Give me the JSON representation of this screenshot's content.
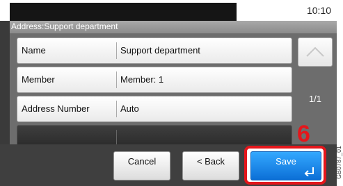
{
  "status_bar": {
    "time": "10:10"
  },
  "title": "Address:Support department",
  "fields": [
    {
      "label": "Name",
      "value": "Support department"
    },
    {
      "label": "Member",
      "value": "Member: 1"
    },
    {
      "label": "Address Number",
      "value": "Auto"
    },
    {
      "label": "",
      "value": ""
    }
  ],
  "pagination": {
    "current": "1/1"
  },
  "buttons": {
    "cancel": "Cancel",
    "back": "< Back",
    "save": "Save"
  },
  "annotation": {
    "step": "6",
    "figure_code": "GB0787_01"
  },
  "colors": {
    "save_blue": "#1e88e5",
    "highlight_red": "#e4161b"
  }
}
